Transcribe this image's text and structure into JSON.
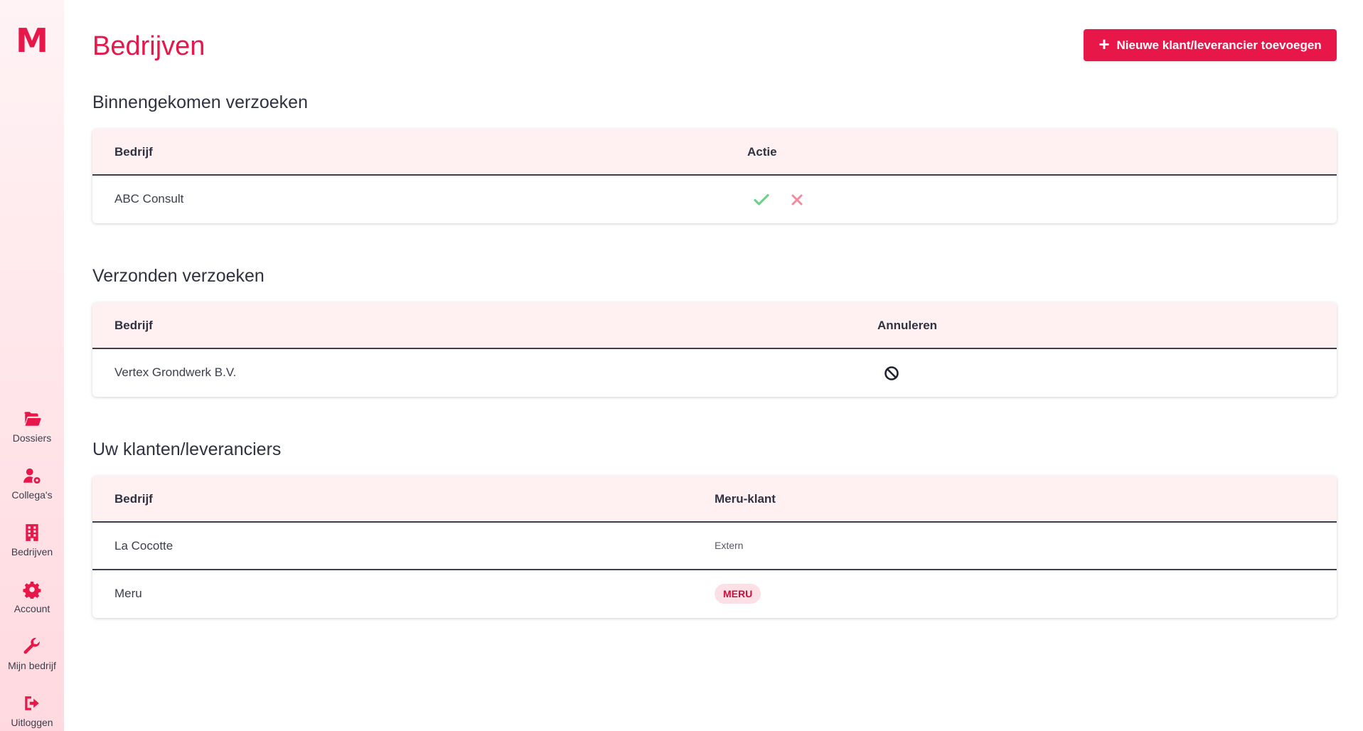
{
  "brand": {
    "logo_letter": "M",
    "accent": "#e8174a"
  },
  "sidebar": {
    "items": [
      {
        "label": "Dossiers",
        "icon": "folder-open-icon"
      },
      {
        "label": "Collega's",
        "icon": "user-gear-icon"
      },
      {
        "label": "Bedrijven",
        "icon": "building-icon"
      },
      {
        "label": "Account",
        "icon": "gear-icon"
      },
      {
        "label": "Mijn bedrijf",
        "icon": "wrench-icon"
      },
      {
        "label": "Uitloggen",
        "icon": "logout-icon"
      }
    ]
  },
  "header": {
    "title": "Bedrijven",
    "add_button_label": "Nieuwe klant/leverancier toevoegen"
  },
  "incoming": {
    "title": "Binnengekomen verzoeken",
    "columns": [
      "Bedrijf",
      "Actie"
    ],
    "rows": [
      {
        "company": "ABC Consult",
        "actions": [
          "accept-check-icon",
          "reject-x-icon"
        ]
      }
    ]
  },
  "sent": {
    "title": "Verzonden verzoeken",
    "columns": [
      "Bedrijf",
      "Annuleren"
    ],
    "rows": [
      {
        "company": "Vertex Grondwerk B.V.",
        "action": "cancel-ban-icon"
      }
    ]
  },
  "clients": {
    "title": "Uw klanten/leveranciers",
    "columns": [
      "Bedrijf",
      "Meru-klant"
    ],
    "rows": [
      {
        "company": "La Cocotte",
        "status": "Extern"
      },
      {
        "company": "Meru",
        "status": "MERU"
      }
    ]
  }
}
